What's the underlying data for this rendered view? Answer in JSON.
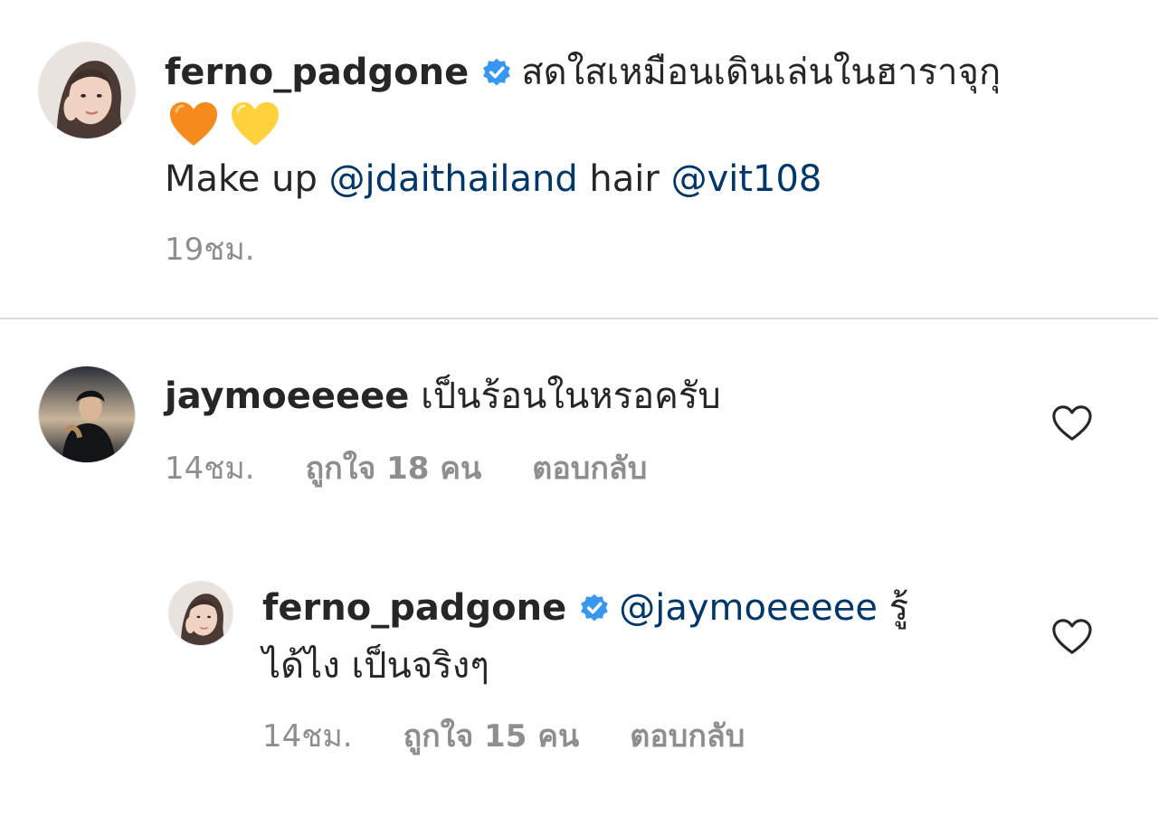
{
  "caption": {
    "username": "ferno_padgone",
    "text": "สดใสเหมือนเดินเล่นในฮาราจุกุ",
    "emojis": [
      "orange-heart",
      "yellow-heart"
    ],
    "makeup_label": "Make up",
    "makeup_mention": "@jdaithailand",
    "hair_label": "hair",
    "hair_mention": "@vit108",
    "time": "19ชม."
  },
  "comments": [
    {
      "username": "jaymoeeeee",
      "text": "เป็นร้อนในหรอครับ",
      "time": "14ชม.",
      "likes": "ถูกใจ 18 คน",
      "reply": "ตอบกลับ"
    },
    {
      "username": "ferno_padgone",
      "mention": "@jaymoeeeee",
      "text_line1_end": "รู้",
      "text_line2": "ได้ไง เป็นจริงๆ",
      "time": "14ชม.",
      "likes": "ถูกใจ 15 คน",
      "reply": "ตอบกลับ"
    }
  ],
  "colors": {
    "text": "#262626",
    "mention": "#00376b",
    "meta": "#8e8e8e",
    "verified": "#3897f0",
    "divider": "#dbdbdb"
  },
  "icons": [
    "verified-badge-icon",
    "heart-outline-icon"
  ]
}
